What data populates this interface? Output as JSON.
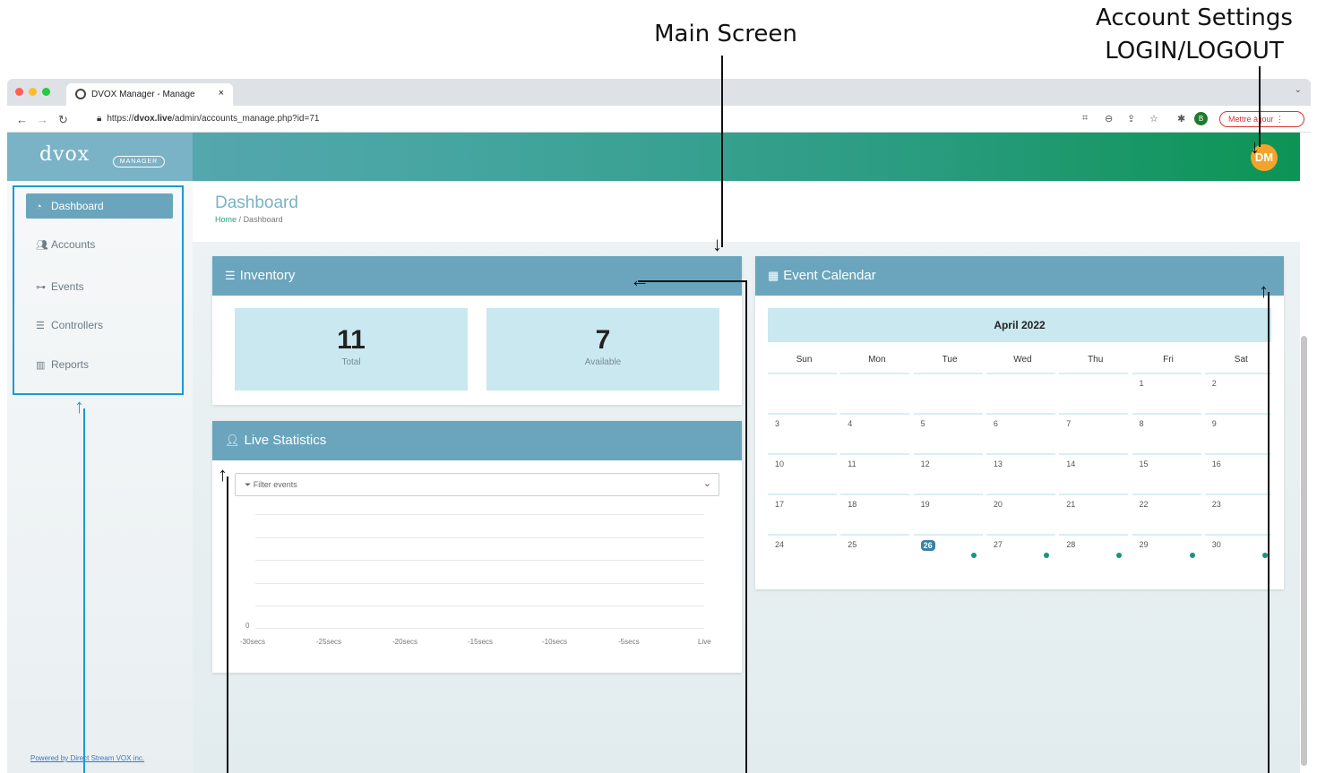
{
  "annotations": {
    "main_screen": "Main Screen",
    "account_settings_line1": "Account Settings",
    "account_settings_line2": "LOGIN/LOGOUT"
  },
  "browser": {
    "tab_title": "DVOX Manager - Manage",
    "tab_close": "×",
    "url_prefix": "https://",
    "url_host": "dvox.live",
    "url_path": "/admin/accounts_manage.php?id=71",
    "profile_initial": "B",
    "update_label": "Mettre à jour"
  },
  "app": {
    "logo_text": "dvox",
    "logo_badge": "MANAGER",
    "avatar_initials": "DM",
    "colors": {
      "header_start": "#5fa8b7",
      "header_end": "#0c9454",
      "accent": "#6aa5bd",
      "avatar": "#f4a32a"
    }
  },
  "sidebar": {
    "items": [
      {
        "label": "Dashboard",
        "icon": "gauge-icon",
        "active": true
      },
      {
        "label": "Accounts",
        "icon": "users-icon",
        "active": false
      },
      {
        "label": "Events",
        "icon": "sitemap-icon",
        "active": false
      },
      {
        "label": "Controllers",
        "icon": "list-icon",
        "active": false
      },
      {
        "label": "Reports",
        "icon": "chart-icon",
        "active": false
      }
    ],
    "footer": "Powered by Direct Stream VOX inc."
  },
  "page": {
    "title": "Dashboard",
    "breadcrumb_home": "Home",
    "breadcrumb_sep": "/",
    "breadcrumb_current": "Dashboard"
  },
  "inventory": {
    "title": "Inventory",
    "total_value": "11",
    "total_label": "Total",
    "available_value": "7",
    "available_label": "Available"
  },
  "live_stats": {
    "title": "Live Statistics",
    "filter_placeholder": "Filter events",
    "y_zero": "0",
    "x_ticks": [
      "-30secs",
      "-25secs",
      "-20secs",
      "-15secs",
      "-10secs",
      "-5secs",
      "Live"
    ]
  },
  "calendar": {
    "title": "Event Calendar",
    "month": "April 2022",
    "days_of_week": [
      "Sun",
      "Mon",
      "Tue",
      "Wed",
      "Thu",
      "Fri",
      "Sat"
    ],
    "today": "26",
    "weeks": [
      [
        "",
        "",
        "",
        "",
        "",
        "1",
        "2"
      ],
      [
        "3",
        "4",
        "5",
        "6",
        "7",
        "8",
        "9"
      ],
      [
        "10",
        "11",
        "12",
        "13",
        "14",
        "15",
        "16"
      ],
      [
        "17",
        "18",
        "19",
        "20",
        "21",
        "22",
        "23"
      ],
      [
        "24",
        "25",
        "26",
        "27",
        "28",
        "29",
        "30"
      ]
    ],
    "event_dot_color": "#16957c"
  }
}
